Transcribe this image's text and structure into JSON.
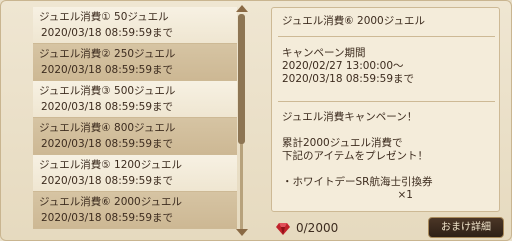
{
  "rewards": [
    {
      "title": "ジュエル消費① 50ジュエル",
      "deadline": "2020/03/18 08:59:59まで"
    },
    {
      "title": "ジュエル消費② 250ジュエル",
      "deadline": "2020/03/18 08:59:59まで"
    },
    {
      "title": "ジュエル消費③ 500ジュエル",
      "deadline": "2020/03/18 08:59:59まで"
    },
    {
      "title": "ジュエル消費④ 800ジュエル",
      "deadline": "2020/03/18 08:59:59まで"
    },
    {
      "title": "ジュエル消費⑤ 1200ジュエル",
      "deadline": "2020/03/18 08:59:59まで"
    },
    {
      "title": "ジュエル消費⑥ 2000ジュエル",
      "deadline": "2020/03/18 08:59:59まで"
    }
  ],
  "detail": {
    "title": "ジュエル消費⑥ 2000ジュエル",
    "period": "キャンペーン期間\n2020/02/27 13:00:00～\n2020/03/18 08:59:59まで",
    "description": "ジュエル消費キャンペーン！\n\n累計2000ジュエル消費で\n下記のアイテムをプレゼント！\n\n・ホワイトデーSR航海士引換券\n　　　　　　　　　　　×1"
  },
  "progress": "0/2000",
  "detail_button": "おまけ詳細",
  "colors": {
    "gem": "#c0222b",
    "button_bg": "#3a2a1c"
  }
}
